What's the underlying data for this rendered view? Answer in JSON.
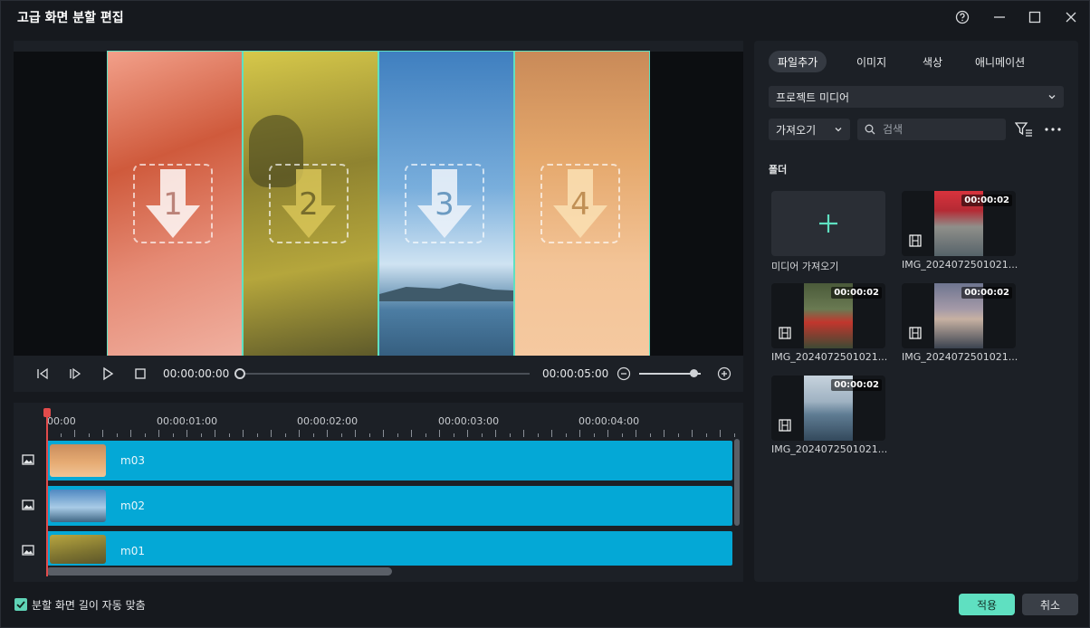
{
  "window": {
    "title": "고급 화면 분할 편집"
  },
  "preview": {
    "panels": [
      {
        "number": "1"
      },
      {
        "number": "2"
      },
      {
        "number": "3"
      },
      {
        "number": "4"
      }
    ]
  },
  "playback": {
    "current_time": "00:00:00:00",
    "total_time": "00:00:05:00",
    "progress": 0,
    "zoom_level": 0.85
  },
  "timeline": {
    "ruler_labels": [
      "00:00",
      "00:00:01:00",
      "00:00:02:00",
      "00:00:03:00",
      "00:00:04:00"
    ],
    "tracks": [
      {
        "label": "m03"
      },
      {
        "label": "m02"
      },
      {
        "label": "m01"
      }
    ]
  },
  "media_panel": {
    "tabs": [
      "파일추가",
      "이미지",
      "색상",
      "애니메이션"
    ],
    "active_tab": "파일추가",
    "source_dropdown": "프로젝트 미디어",
    "import_button": "가져오기",
    "search_placeholder": "검색",
    "folder_label": "폴더",
    "import_card_label": "미디어 가져오기",
    "items": [
      {
        "name": "IMG_2024072501021...",
        "duration": "00:00:02"
      },
      {
        "name": "IMG_2024072501021...",
        "duration": "00:00:02"
      },
      {
        "name": "IMG_2024072501021...",
        "duration": "00:00:02"
      },
      {
        "name": "IMG_2024072501021...",
        "duration": "00:00:02"
      }
    ]
  },
  "footer": {
    "auto_fit_label": "분할 화면 길이 자동 맞춤",
    "auto_fit_checked": true,
    "apply_button": "적용",
    "cancel_button": "취소"
  },
  "colors": {
    "accent": "#5fe0c1",
    "clip": "#04a8d6",
    "playhead": "#e24b4b"
  }
}
